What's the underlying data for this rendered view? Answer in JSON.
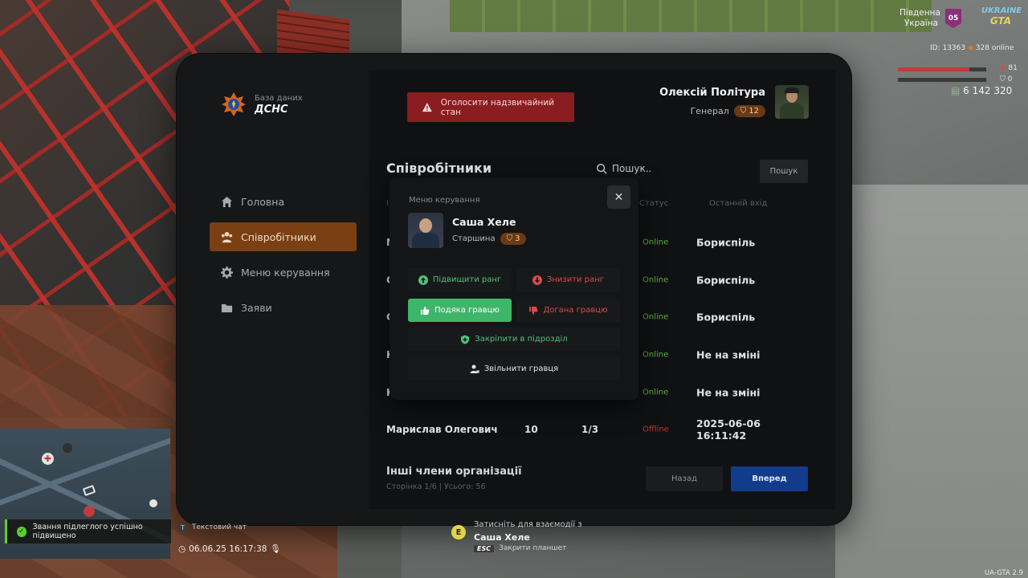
{
  "tablet": {
    "brand_sub": "База даних",
    "brand_name": "ДСНС",
    "alarm_label": "Оголосити надзвичайний стан",
    "user": {
      "name": "Олексій Політура",
      "rank": "Генерал",
      "rank_level": "12"
    },
    "nav": [
      {
        "label": "Головна",
        "icon": "home-icon"
      },
      {
        "label": "Співробітники",
        "icon": "users-icon",
        "active": true
      },
      {
        "label": "Меню керування",
        "icon": "gear-icon"
      },
      {
        "label": "Заяви",
        "icon": "folder-icon"
      }
    ],
    "section_title": "Співробітники",
    "search_placeholder": "Пошук..",
    "search_button": "Пошук",
    "columns": {
      "status": "Статус",
      "last_login": "Останній вхід",
      "first": "І"
    },
    "rows": [
      {
        "name": "N",
        "status": "Online",
        "location": "Бориспіль"
      },
      {
        "name": "C",
        "status": "Online",
        "location": "Бориспіль"
      },
      {
        "name": "C",
        "status": "Online",
        "location": "Бориспіль"
      },
      {
        "name": "K",
        "status": "Online",
        "location": "Не на зміні"
      },
      {
        "name": "K",
        "status": "Online",
        "location": "Не на зміні"
      },
      {
        "name": "Марислав Олегович",
        "level": "10",
        "warns": "1/3",
        "status": "Offline",
        "location": "2025-06-06 16:11:42"
      }
    ],
    "footer_title": "Інші члени організації",
    "footer_sub": "Сторінка 1/6 | Усього: 56",
    "prev_label": "Назад",
    "next_label": "Вперед"
  },
  "modal": {
    "title": "Меню керування",
    "close": "✕",
    "player_name": "Саша Хеле",
    "player_rank": "Старшина",
    "player_rank_level": "3",
    "promote": "Підвищити ранг",
    "demote": "Знизити ранг",
    "thank": "Подяка гравцю",
    "reprimand": "Догана гравцю",
    "assign": "Закріпити в підрозділ",
    "fire": "Звільнити гравця"
  },
  "hud": {
    "region_line1": "Південна",
    "region_line2": "Україна",
    "region_badge": "05",
    "server_logo_1": "UKRAINE",
    "server_logo_2": "GTA",
    "player_id": "ID: 13363",
    "online": "328 online",
    "health": "81",
    "armor": "0",
    "money": "6 142 320",
    "toast": "Звання підлеглого успішно підвищено",
    "chat_key": "T",
    "chat_label": "Текстовий чат",
    "datetime": "06.06.25 16:17:38",
    "interact_key": "E",
    "interact_hint": "Затисніть для взаємодії з",
    "interact_target": "Саша Хеле",
    "esc_key": "ESC",
    "esc_label": "Закрити планшет",
    "version": "UA-GTA 2.9"
  },
  "colors": {
    "accent_orange": "#7a3f12",
    "alarm_red": "#8a1d20",
    "online_green": "#5fae3a",
    "offline_red": "#b83a2d",
    "next_blue": "#123b8b",
    "thank_green": "#3fb56a"
  }
}
